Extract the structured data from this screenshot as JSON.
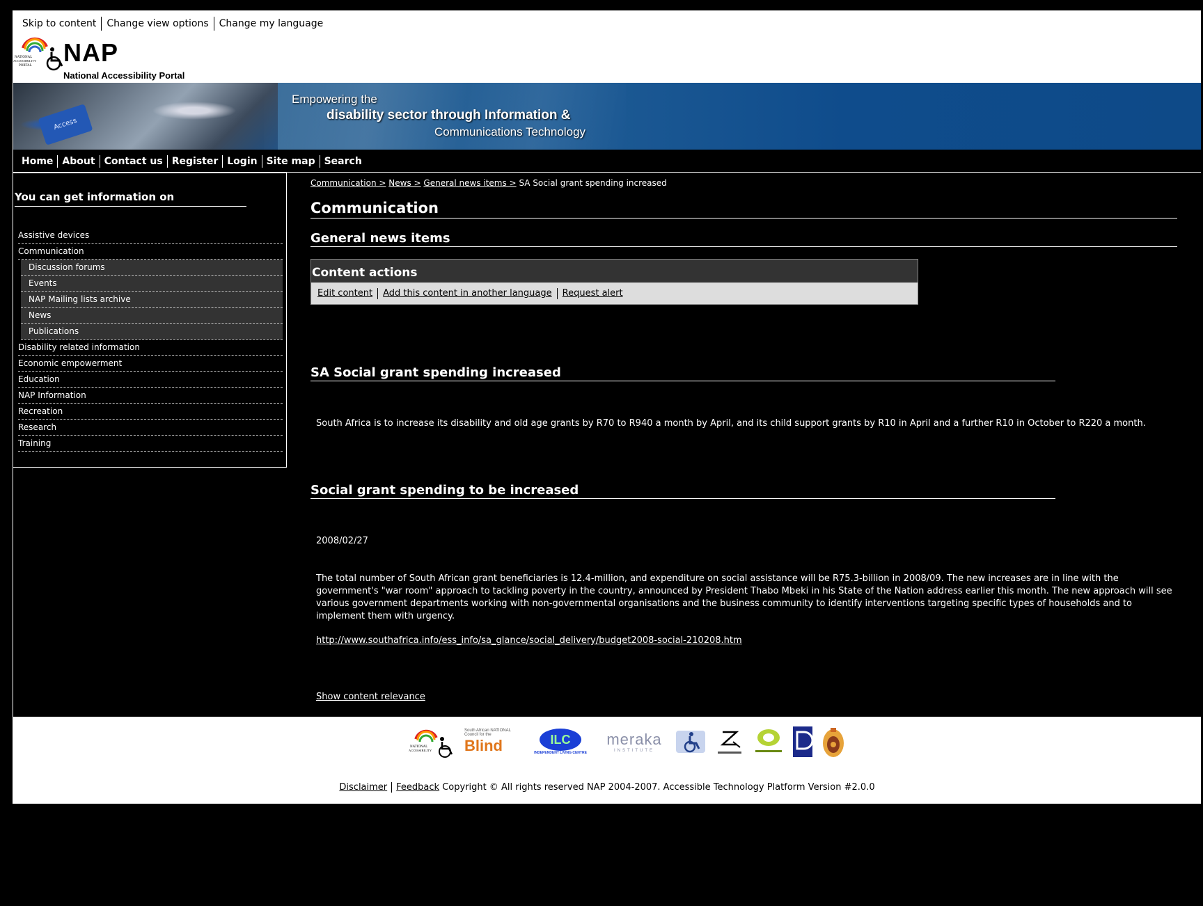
{
  "skip_links": [
    "Skip to content",
    "Change view options",
    "Change my language"
  ],
  "logo": {
    "title": "NAP",
    "subtitle": "National Accessibility Portal"
  },
  "banner": {
    "line1": "Empowering the",
    "line2": "disability sector through Information &",
    "line3": "Communications Technology",
    "key_label": "Access"
  },
  "topnav": [
    "Home",
    "About",
    "Contact us",
    "Register",
    "Login",
    "Site map",
    "Search"
  ],
  "sidebar": {
    "title": "You can get information on",
    "items": [
      {
        "label": "Assistive devices",
        "sub": false
      },
      {
        "label": "Communication",
        "sub": false
      },
      {
        "label": "Discussion forums",
        "sub": true
      },
      {
        "label": "Events",
        "sub": true
      },
      {
        "label": "NAP Mailing lists archive",
        "sub": true
      },
      {
        "label": "News",
        "sub": true
      },
      {
        "label": "Publications",
        "sub": true
      },
      {
        "label": "Disability related information",
        "sub": false
      },
      {
        "label": "Economic empowerment",
        "sub": false
      },
      {
        "label": "Education",
        "sub": false
      },
      {
        "label": "NAP Information",
        "sub": false
      },
      {
        "label": "Recreation",
        "sub": false
      },
      {
        "label": "Research",
        "sub": false
      },
      {
        "label": "Training",
        "sub": false
      }
    ]
  },
  "breadcrumb": {
    "links": [
      "Communication >",
      "News >",
      "General news items >"
    ],
    "current": "SA Social grant spending increased"
  },
  "main": {
    "heading": "Communication",
    "subheading": "General news items",
    "actions_title": "Content actions",
    "actions": [
      "Edit content",
      "Add this content in another language",
      "Request alert"
    ],
    "article1_title": "SA Social grant spending increased",
    "article1_body": "South Africa is to increase its disability and old age grants by R70 to R940 a month by April, and its child support grants by R10 in April and a further R10 in October to R220 a month.",
    "article2_title": "Social grant spending to be increased",
    "article2_date": "2008/02/27",
    "article2_body": "The total number of South African grant beneficiaries is 12.4-million, and expenditure on social assistance will be R75.3-billion in 2008/09. The new increases are in line with the government's \"war room\" approach to tackling poverty in the country, announced by President Thabo Mbeki in his State of the Nation address earlier this month. The new approach will see various government departments working with non-governmental organisations and the business community to identify interventions targeting specific types of households and to implement them with urgency.",
    "article2_link": "http://www.southafrica.info/ess_info/sa_glance/social_delivery/budget2008-social-210208.htm",
    "relevance_link": "Show content relevance"
  },
  "partners": {
    "blind_top": "South African NATIONAL Council for the",
    "blind_main": "Blind",
    "ilc": "ILC",
    "ilc_sub": "INDEPENDENT LIVING CENTRE",
    "meraka": "meraka",
    "meraka_sub": "INSTITUTE"
  },
  "footer": {
    "links": [
      "Disclaimer",
      "Feedback"
    ],
    "text": "Copyright © All rights reserved NAP 2004-2007. Accessible Technology Platform Version #2.0.0"
  },
  "colors": {
    "banner_blue": "#0f4c8c",
    "actions_bg": "#333333",
    "actions_bar": "#dddddd"
  }
}
